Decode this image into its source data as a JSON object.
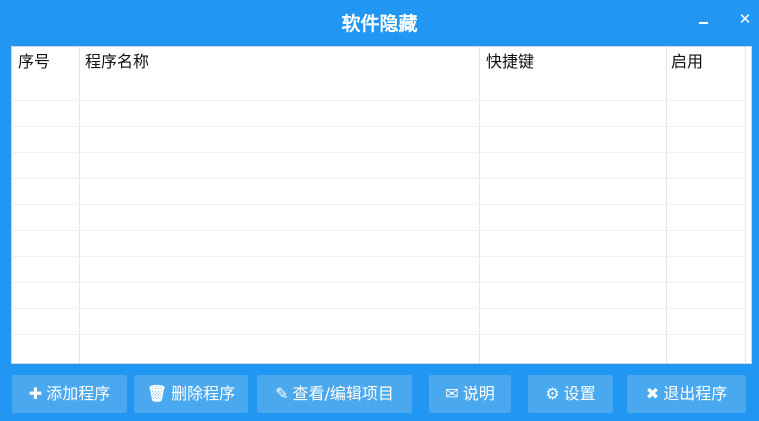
{
  "window": {
    "title": "软件隐藏",
    "minimize_icon": "minimize-icon",
    "close_glyph": "✕"
  },
  "table": {
    "columns": [
      "序号",
      "程序名称",
      "快捷键",
      "启用"
    ],
    "rows": []
  },
  "buttons": {
    "add": {
      "label": "添加程序",
      "icon": "plus-icon",
      "glyph": "✚"
    },
    "delete": {
      "label": "删除程序",
      "icon": "trash-icon",
      "glyph": "🗑"
    },
    "edit": {
      "label": "查看/编辑项目",
      "icon": "edit-icon",
      "glyph": "✎"
    },
    "help": {
      "label": "说明",
      "icon": "envelope-icon",
      "glyph": "✉"
    },
    "settings": {
      "label": "设置",
      "icon": "gear-icon",
      "glyph": "⚙"
    },
    "exit": {
      "label": "退出程序",
      "icon": "close-icon",
      "glyph": "✖"
    }
  },
  "colors": {
    "window_bg": "#2196f3",
    "button_bg": "#4aa8ee",
    "text_light": "#ffffff"
  }
}
